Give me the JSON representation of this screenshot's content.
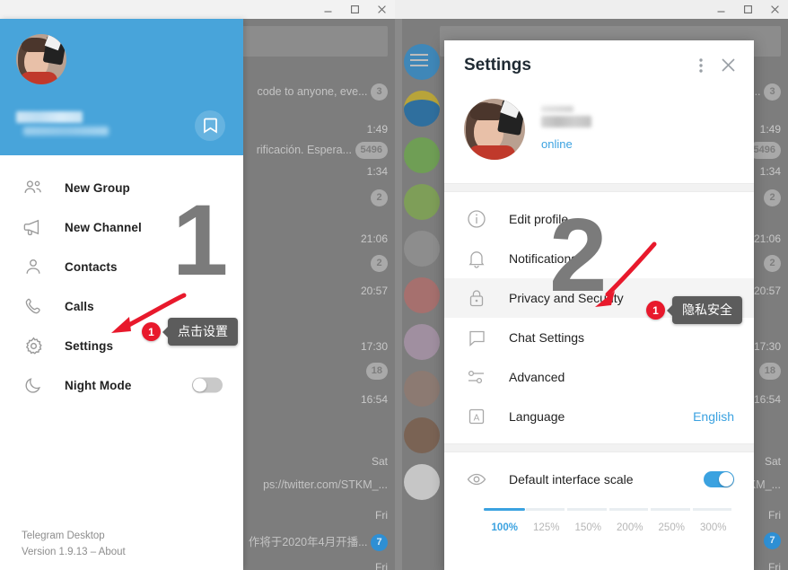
{
  "windows": {
    "left": {
      "titlebar": {
        "minimize": "minimize-icon",
        "maximize": "maximize-icon",
        "close": "close-icon"
      },
      "drawer": {
        "saved_messages_icon": "bookmark-icon",
        "menu": [
          {
            "label": "New Group",
            "icon": "group-icon"
          },
          {
            "label": "New Channel",
            "icon": "megaphone-icon"
          },
          {
            "label": "Contacts",
            "icon": "person-icon"
          },
          {
            "label": "Calls",
            "icon": "phone-icon"
          },
          {
            "label": "Settings",
            "icon": "gear-icon"
          },
          {
            "label": "Night Mode",
            "icon": "moon-icon",
            "toggle": "off"
          }
        ],
        "footer": {
          "app_name": "Telegram Desktop",
          "version": "Version 1.9.13 – About"
        }
      },
      "chat_list": [
        {
          "snippet": "code to anyone, eve...",
          "badge": "3"
        },
        {
          "time": "1:49"
        },
        {
          "snippet": "rificación. Espera...",
          "badge": "5496"
        },
        {
          "time": "1:34",
          "badge": "2"
        },
        {
          "time": "21:06",
          "badge": "2"
        },
        {
          "time": "20:57"
        },
        {
          "time": "17:30",
          "badge": "18"
        },
        {
          "time": "16:54"
        },
        {
          "time": "Sat",
          "snippet": "ps://twitter.com/STKM_..."
        },
        {
          "time": "Fri",
          "snippet": "作将于2020年4月开播...",
          "badge": "7"
        },
        {
          "time": "Fri"
        }
      ],
      "annotation": {
        "step_number": "1",
        "badge": "1",
        "tooltip": "点击设置"
      }
    },
    "right": {
      "titlebar": {
        "minimize": "minimize-icon",
        "maximize": "maximize-icon",
        "close": "close-icon"
      },
      "menu_icon": "hamburger-icon",
      "settings": {
        "title": "Settings",
        "more_icon": "more-vertical-icon",
        "close_icon": "close-icon",
        "profile": {
          "status": "online",
          "avatar": "user-avatar"
        },
        "items": [
          {
            "label": "Edit profile",
            "icon": "info-icon",
            "value": ""
          },
          {
            "label": "Notifications",
            "icon": "bell-icon",
            "value": ""
          },
          {
            "label": "Privacy and Security",
            "icon": "lock-icon",
            "value": "",
            "active": true
          },
          {
            "label": "Chat Settings",
            "icon": "chat-bubble-icon",
            "value": ""
          },
          {
            "label": "Advanced",
            "icon": "sliders-icon",
            "value": ""
          },
          {
            "label": "Language",
            "icon": "letter-a-icon",
            "value": "English"
          }
        ],
        "scale": {
          "label": "Default interface scale",
          "icon": "eye-icon",
          "toggle": "on",
          "selected": "100%",
          "options": [
            "100%",
            "125%",
            "150%",
            "200%",
            "250%",
            "300%"
          ]
        }
      },
      "chat_list": [
        {
          "snippet": "e...",
          "badge": "3"
        },
        {
          "time": "1:49",
          "badge": "5496"
        },
        {
          "time": "1:34",
          "badge": "2"
        },
        {
          "time": "21:06",
          "badge": "2"
        },
        {
          "time": "20:57"
        },
        {
          "time": "17:30",
          "badge": "18"
        },
        {
          "time": "16:54"
        },
        {
          "time": "Sat",
          "snippet": "KM_..."
        },
        {
          "time": "Fri",
          "badge": "7"
        },
        {
          "time": "Fri"
        }
      ],
      "annotation": {
        "step_number": "2",
        "badge": "1",
        "tooltip": "隐私安全"
      }
    }
  },
  "colors": {
    "brand_blue": "#48a4da",
    "link_blue": "#3ba2e0",
    "badge_red": "#e8192c",
    "tooltip_grey": "#5c5c5c",
    "step_grey": "#7b7b7b"
  }
}
